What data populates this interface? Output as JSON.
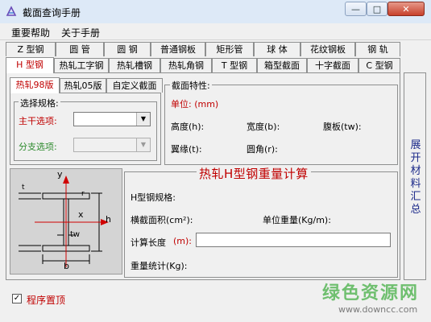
{
  "window": {
    "title": "截面查询手册",
    "minimize": "—",
    "maximize": "□",
    "close": "✕"
  },
  "menu": {
    "items": [
      "重要帮助",
      "关于手册"
    ]
  },
  "main_tabs_row1": [
    "Z 型钢",
    "圆  管",
    "圆  钢",
    "普通钢板",
    "矩形管",
    "球  体",
    "花纹钢板",
    "钢  轨"
  ],
  "main_tabs_row2": [
    "H 型钢",
    "热轧工字钢",
    "热轧槽钢",
    "热轧角钢",
    "T 型钢",
    "箱型截面",
    "十字截面",
    "C 型钢"
  ],
  "main_tabs_selected": "H 型钢",
  "sub_tabs": [
    "热轧98版",
    "热轧05版",
    "自定义截面"
  ],
  "sub_tabs_selected": "热轧98版",
  "spec_group": {
    "title": "选择规格:",
    "main_label": "主干选项:",
    "main_value": "",
    "branch_label": "分支选项:",
    "branch_value": ""
  },
  "properties": {
    "title": "截面特性:",
    "unit": "单位: (mm)",
    "height": "高度(h):",
    "width": "宽度(b):",
    "web": "腹板(tw):",
    "flange": "翼缘(t):",
    "radius": "圆角(r):"
  },
  "diagram": {
    "y": "y",
    "x": "x",
    "h": "h",
    "b": "b",
    "tw": "tw",
    "t": "t",
    "r": "r"
  },
  "calc": {
    "title": "热轧H型钢重量计算",
    "spec": "H型钢规格:",
    "area": "横截面积(cm²):",
    "unit_weight": "单位重量(Kg/m):",
    "length_label": "计算长度",
    "length_unit": "(m):",
    "length_value": "",
    "total": "重量统计(Kg):"
  },
  "side_button": "展开材料汇总",
  "pin": {
    "label": "程序置顶",
    "checked": "✓"
  },
  "watermark": {
    "title": "绿色资源网",
    "url": "www.downcc.com"
  }
}
